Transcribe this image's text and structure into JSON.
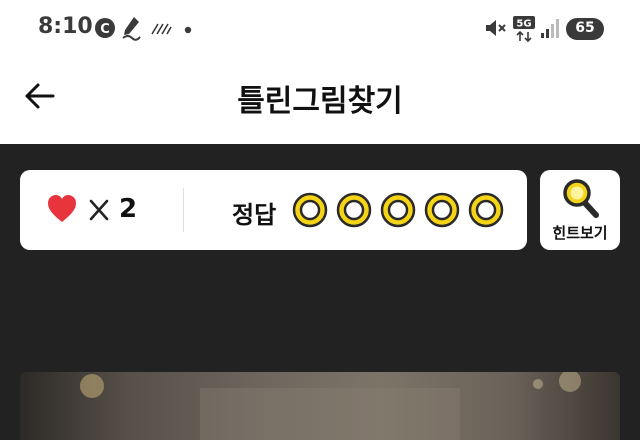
{
  "status_bar": {
    "time": "8:10",
    "network": "5G",
    "battery": "65",
    "icons": [
      "c-badge-icon",
      "pen-icon",
      "hatched-icon",
      "dot-icon",
      "mute-icon",
      "network-5g-icon",
      "signal-icon",
      "battery-icon"
    ]
  },
  "header": {
    "title": "틀린그림찾기",
    "back_icon": "arrow-left-icon"
  },
  "game": {
    "lives_icon": "heart-icon",
    "lives_multiplier_icon": "times-icon",
    "lives": "2",
    "answer_label": "정답",
    "answers_found": 0,
    "answers_total": 5,
    "hint_label": "힌트보기",
    "hint_icon": "magnifier-icon"
  },
  "colors": {
    "background": "#222222",
    "card": "#ffffff",
    "heart": "#e8343c",
    "ring": "#f5d415",
    "ring_outline": "#2a2a2a"
  }
}
